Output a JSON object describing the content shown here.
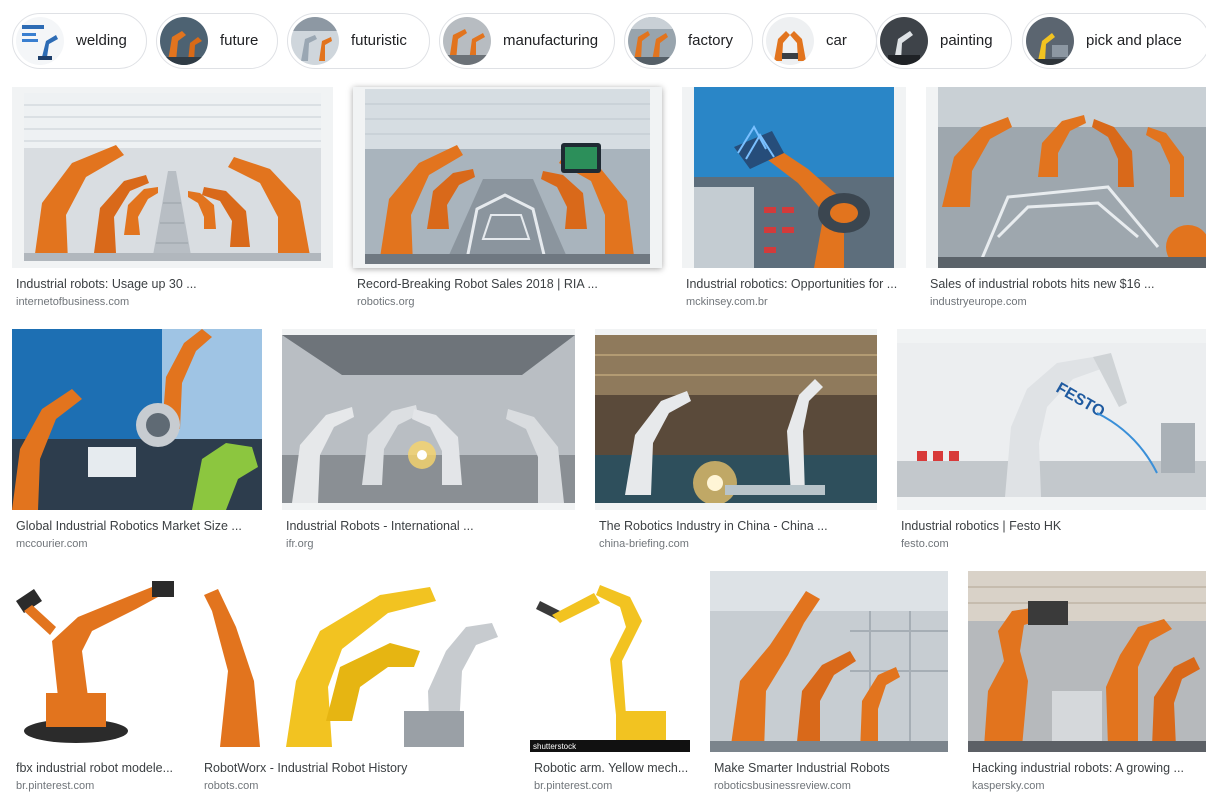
{
  "chips": [
    {
      "label": "welding"
    },
    {
      "label": "future"
    },
    {
      "label": "futuristic"
    },
    {
      "label": "manufacturing"
    },
    {
      "label": "factory"
    },
    {
      "label": "car"
    },
    {
      "label": "painting"
    },
    {
      "label": "pick and place"
    }
  ],
  "results": [
    {
      "title": "Industrial robots: Usage up 30 ...",
      "domain": "internetofbusiness.com"
    },
    {
      "title": "Record-Breaking Robot Sales 2018 | RIA ...",
      "domain": "robotics.org"
    },
    {
      "title": "Industrial robotics: Opportunities for ...",
      "domain": "mckinsey.com.br"
    },
    {
      "title": "Sales of industrial robots hits new $16 ...",
      "domain": "industryeurope.com"
    },
    {
      "title": "Global Industrial Robotics Market Size ...",
      "domain": "mccourier.com"
    },
    {
      "title": "Industrial Robots - International ...",
      "domain": "ifr.org"
    },
    {
      "title": "The Robotics Industry in China - China ...",
      "domain": "china-briefing.com"
    },
    {
      "title": "Industrial robotics | Festo HK",
      "domain": "festo.com"
    },
    {
      "title": "fbx industrial robot modele...",
      "domain": "br.pinterest.com"
    },
    {
      "title": "RobotWorx - Industrial Robot History",
      "domain": "robots.com"
    },
    {
      "title": "Robotic arm. Yellow mech...",
      "domain": "br.pinterest.com"
    },
    {
      "title": "Make Smarter Industrial Robots",
      "domain": "roboticsbusinessreview.com"
    },
    {
      "title": "Hacking industrial robots: A growing ...",
      "domain": "kaspersky.com"
    }
  ],
  "image_watermarks": {
    "shutterstock": "shutterstock",
    "festo": "FESTO"
  },
  "colors": {
    "robot_orange": "#e2741e",
    "robot_yellow": "#f2c321",
    "border": "#dfe1e5",
    "title_text": "#3c4043",
    "domain_text": "#70757a"
  }
}
